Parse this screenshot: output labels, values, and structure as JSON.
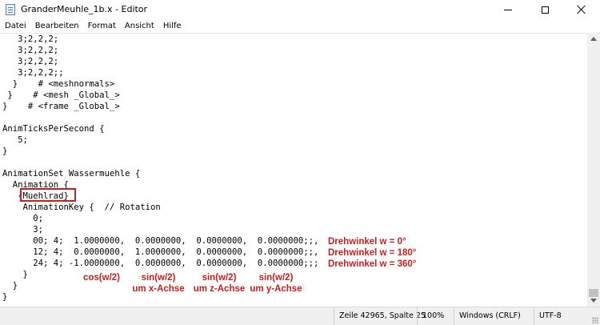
{
  "window": {
    "title": "GranderMeuhle_1b.x - Editor"
  },
  "menu": {
    "items": [
      "Datei",
      "Bearbeiten",
      "Format",
      "Ansicht",
      "Hilfe"
    ]
  },
  "editor": {
    "lines": [
      "   3;2,2,2;",
      "   3;2,2,2;",
      "   3;2,2,2;",
      "   3;2,2,2;;",
      "  }    # <meshnormals>",
      " }    # <mesh _Global_>",
      "}    # <frame _Global_>",
      "",
      "AnimTicksPerSecond {",
      "   5;",
      "}",
      "",
      "AnimationSet Wassermuehle {",
      "  Animation {",
      "   {Muehlrad}",
      "    AnimationKey {  // Rotation",
      "      0;",
      "      3;",
      "      00; 4;  1.0000000,  0.0000000,  0.0000000,  0.0000000;;,",
      "      12; 4;  0.0000000,  1.0000000,  0.0000000,  0.0000000;;,",
      "      24; 4; -1.0000000,  0.0000000,  0.0000000,  0.0000000;;;",
      "    }",
      "  }",
      "}"
    ]
  },
  "annotations": {
    "drehwinkel": [
      "Drehwinkel w = 0°",
      "Drehwinkel w = 180°",
      "Drehwinkel w = 360°"
    ],
    "columns": {
      "cos": "cos(w/2)",
      "sin_x": [
        "sin(w/2)",
        "um x-Achse"
      ],
      "sin_z": [
        "sin(w/2)",
        "um z-Achse"
      ],
      "sin_y": [
        "sin(w/2)",
        "um y-Achse"
      ]
    },
    "color": "#c81e1e"
  },
  "status": {
    "position": "Zeile 42965, Spalte 25",
    "zoom": "100%",
    "line_endings": "Windows (CRLF)",
    "encoding": "UTF-8"
  },
  "icons": {
    "app": "notepad-icon",
    "minimize": "minimize-icon",
    "maximize": "maximize-icon",
    "close": "close-icon"
  }
}
